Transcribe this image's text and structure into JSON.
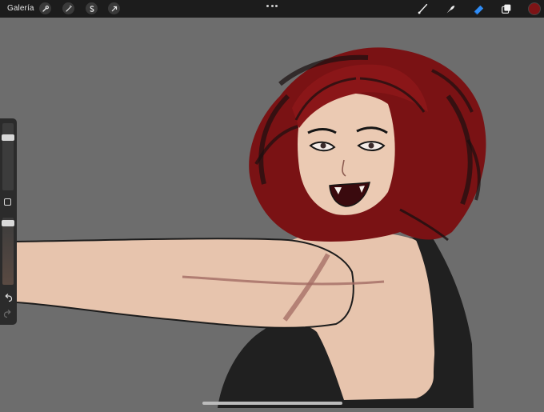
{
  "topbar": {
    "gallery_label": "Galería",
    "left_tools": [
      {
        "icon": "wrench-icon"
      },
      {
        "icon": "magic-wand-icon"
      },
      {
        "icon": "selection-s-icon"
      },
      {
        "icon": "transform-arrow-icon"
      }
    ],
    "more_icon": "ellipsis-icon",
    "right_tools": [
      {
        "icon": "brush-icon"
      },
      {
        "icon": "smudge-icon"
      },
      {
        "icon": "eraser-icon",
        "active": true,
        "color": "#2f8cf5"
      },
      {
        "icon": "layers-icon"
      }
    ],
    "current_color": "#7d1416"
  },
  "sidebar": {
    "brush_size_level": 0.1,
    "opacity_level": 0.0,
    "modify_button_icon": "square-icon",
    "undo_icon": "undo-icon",
    "redo_icon": "redo-icon"
  },
  "canvas": {
    "background": "#6d6d6d",
    "artwork": "illustration"
  }
}
